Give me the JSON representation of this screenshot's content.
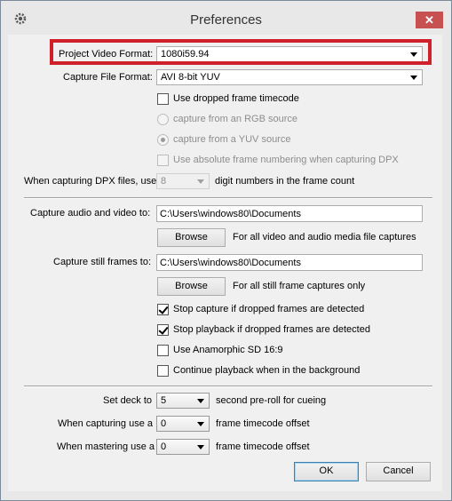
{
  "window": {
    "title": "Preferences",
    "close_glyph": "✕"
  },
  "project_video_format": {
    "label": "Project Video Format:",
    "value": "1080i59.94"
  },
  "capture_file_format": {
    "label": "Capture File Format:",
    "value": "AVI 8-bit YUV"
  },
  "use_dropped_frame_timecode": {
    "label": "Use dropped frame timecode",
    "checked": false
  },
  "capture_rgb": {
    "label": "capture from an RGB source",
    "selected": false,
    "enabled": false
  },
  "capture_yuv": {
    "label": "capture from a YUV source",
    "selected": true,
    "enabled": false
  },
  "absolute_frame_numbering": {
    "label": "Use absolute frame numbering when capturing DPX",
    "checked": false,
    "enabled": false
  },
  "dpx_digits": {
    "label": "When capturing DPX files, use",
    "value": "8",
    "suffix": "digit numbers in the frame count"
  },
  "capture_audio_video": {
    "label": "Capture audio and video to:",
    "value": "C:\\Users\\windows80\\Documents"
  },
  "browse_av": {
    "label": "Browse",
    "note": "For all video and audio media file captures"
  },
  "capture_stills": {
    "label": "Capture still frames to:",
    "value": "C:\\Users\\windows80\\Documents"
  },
  "browse_stills": {
    "label": "Browse",
    "note": "For all still frame captures only"
  },
  "stop_capture_dropped": {
    "label": "Stop capture if dropped frames are detected",
    "checked": true
  },
  "stop_playback_dropped": {
    "label": "Stop playback if dropped frames are detected",
    "checked": true
  },
  "anamorphic_sd": {
    "label": "Use Anamorphic SD 16:9",
    "checked": false
  },
  "continue_playback_bg": {
    "label": "Continue playback when in the background",
    "checked": false
  },
  "set_deck": {
    "label": "Set deck to",
    "value": "5",
    "suffix": "second pre-roll for cueing"
  },
  "capturing_offset": {
    "label": "When capturing use a",
    "value": "0",
    "suffix": "frame timecode offset"
  },
  "mastering_offset": {
    "label": "When mastering use a",
    "value": "0",
    "suffix": "frame timecode offset"
  },
  "ok_button": "OK",
  "cancel_button": "Cancel",
  "highlight_color": "#d0202a",
  "icons": {
    "app": "gear-icon",
    "close": "close-icon",
    "dropdown": "chevron-down-icon"
  }
}
